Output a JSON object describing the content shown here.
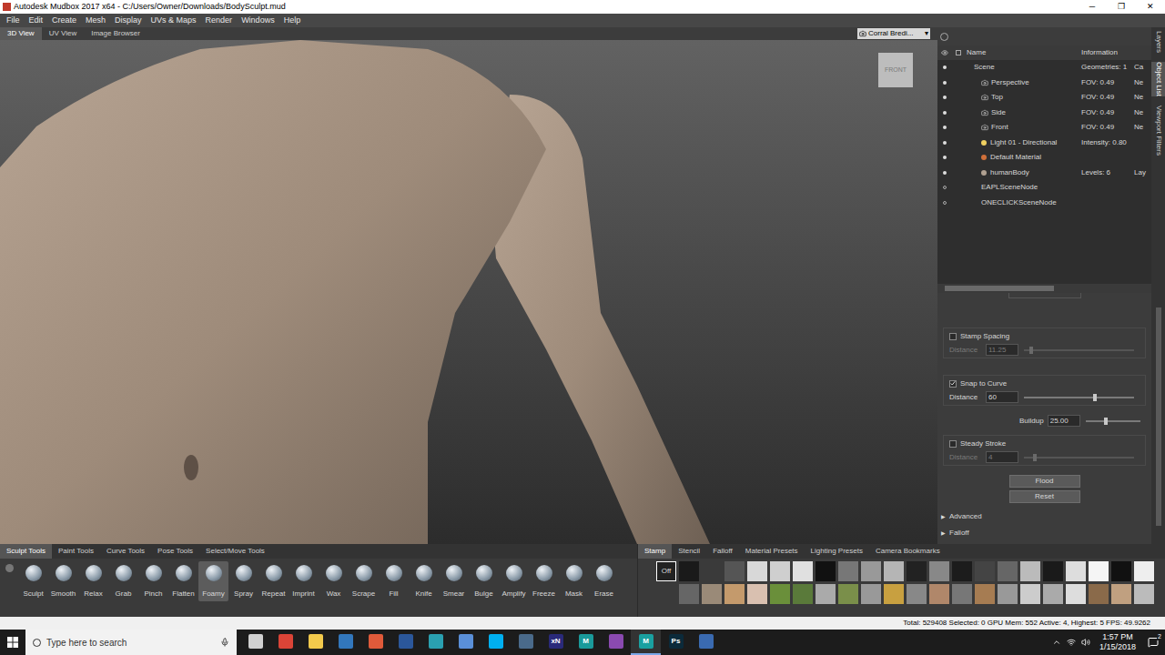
{
  "window": {
    "title": "Autodesk Mudbox 2017 x64 - C:/Users/Owner/Downloads/BodySculpt.mud",
    "controls": [
      "─",
      "❐",
      "✕"
    ]
  },
  "menu": [
    "File",
    "Edit",
    "Create",
    "Mesh",
    "Display",
    "UVs & Maps",
    "Render",
    "Windows",
    "Help"
  ],
  "view_tabs": [
    {
      "label": "3D View",
      "selected": true
    },
    {
      "label": "UV View",
      "selected": false
    },
    {
      "label": "Image Browser",
      "selected": false
    }
  ],
  "camera_menu": {
    "value": "Corral Bredi...",
    "arrow": "▾"
  },
  "viewcube": {
    "label": "FRONT"
  },
  "object_list": {
    "columns": [
      "Name",
      "Information"
    ],
    "rows": [
      {
        "name": "Scene",
        "info": "Geometries: 1",
        "extra": "Ca",
        "depth": 0,
        "kind": "scene",
        "visible": true
      },
      {
        "name": "Perspective",
        "info": "FOV: 0.49",
        "extra": "Ne",
        "depth": 1,
        "kind": "camera",
        "visible": true
      },
      {
        "name": "Top",
        "info": "FOV: 0.49",
        "extra": "Ne",
        "depth": 1,
        "kind": "camera",
        "visible": true
      },
      {
        "name": "Side",
        "info": "FOV: 0.49",
        "extra": "Ne",
        "depth": 1,
        "kind": "camera",
        "visible": true
      },
      {
        "name": "Front",
        "info": "FOV: 0.49",
        "extra": "Ne",
        "depth": 1,
        "kind": "camera",
        "visible": true
      },
      {
        "name": "Light 01 - Directional",
        "info": "Intensity: 0.80",
        "depth": 1,
        "kind": "light",
        "visible": true
      },
      {
        "name": "Default Material",
        "depth": 1,
        "kind": "material",
        "visible": true
      },
      {
        "name": "humanBody",
        "info": "Levels: 6",
        "extra": "Lay",
        "depth": 1,
        "kind": "mesh",
        "visible": true
      },
      {
        "name": "EAPLSceneNode",
        "depth": 1,
        "kind": "node",
        "visible": false
      },
      {
        "name": "ONECLICKSceneNode",
        "depth": 1,
        "kind": "node",
        "visible": false
      }
    ]
  },
  "properties": {
    "stamp_spacing": {
      "label": "Stamp Spacing",
      "checked": false,
      "field_label": "Distance",
      "value": "11.25",
      "level": 0.05,
      "disabled": true
    },
    "snap_to_curve": {
      "label": "Snap to Curve",
      "checked": true,
      "field_label": "Distance",
      "value": "60",
      "level": 0.63,
      "disabled": false
    },
    "buildup": {
      "label": "Buildup",
      "value": "25.00",
      "level": 0.34
    },
    "steady_stroke": {
      "label": "Steady Stroke",
      "checked": false,
      "field_label": "Distance",
      "value": "4",
      "level": 0.08,
      "disabled": true
    },
    "buttons": [
      "Flood",
      "Reset"
    ],
    "sections": [
      {
        "label": "Advanced",
        "expanded": false,
        "arrow": "▶"
      },
      {
        "label": "Falloff",
        "expanded": false,
        "arrow": "▶"
      }
    ]
  },
  "side_tabs": [
    {
      "label": "Layers",
      "selected": false
    },
    {
      "label": "Object List",
      "selected": true
    },
    {
      "label": "Viewport Filters",
      "selected": false
    }
  ],
  "tool_tabs": [
    {
      "label": "Sculpt Tools",
      "selected": true
    },
    {
      "label": "Paint Tools",
      "selected": false
    },
    {
      "label": "Curve Tools",
      "selected": false
    },
    {
      "label": "Pose Tools",
      "selected": false
    },
    {
      "label": "Select/Move Tools",
      "selected": false
    }
  ],
  "tools": [
    {
      "label": "Sculpt",
      "selected": false
    },
    {
      "label": "Smooth",
      "selected": false
    },
    {
      "label": "Relax",
      "selected": false
    },
    {
      "label": "Grab",
      "selected": false
    },
    {
      "label": "Pinch",
      "selected": false
    },
    {
      "label": "Flatten",
      "selected": false
    },
    {
      "label": "Foamy",
      "selected": true
    },
    {
      "label": "Spray",
      "selected": false
    },
    {
      "label": "Repeat",
      "selected": false
    },
    {
      "label": "Imprint",
      "selected": false
    },
    {
      "label": "Wax",
      "selected": false
    },
    {
      "label": "Scrape",
      "selected": false
    },
    {
      "label": "Fill",
      "selected": false
    },
    {
      "label": "Knife",
      "selected": false
    },
    {
      "label": "Smear",
      "selected": false
    },
    {
      "label": "Bulge",
      "selected": false
    },
    {
      "label": "Amplify",
      "selected": false
    },
    {
      "label": "Freeze",
      "selected": false
    },
    {
      "label": "Mask",
      "selected": false
    },
    {
      "label": "Erase",
      "selected": false
    }
  ],
  "stamp_tabs": [
    {
      "label": "Stamp",
      "selected": true
    },
    {
      "label": "Stencil",
      "selected": false
    },
    {
      "label": "Falloff",
      "selected": false
    },
    {
      "label": "Material Presets",
      "selected": false
    },
    {
      "label": "Lighting Presets",
      "selected": false
    },
    {
      "label": "Camera Bookmarks",
      "selected": false
    }
  ],
  "stamps": {
    "off": {
      "label": "Off",
      "selected": true
    },
    "rows": [
      [
        "#1a1a1a",
        "#3a3a3a",
        "#555555",
        "#d8d8d8",
        "#cfcfcf",
        "#e0e0e0",
        "#111111",
        "#777777",
        "#999999",
        "#b5b5b5",
        "#222222",
        "#888888",
        "#1c1c1c",
        "#444444",
        "#666666",
        "#bbbbbb",
        "#1a1a1a",
        "#dddddd",
        "#f5f5f5",
        "#111111",
        "#eeeeee"
      ],
      [
        "#3a3a3a",
        "#666666",
        "#9a8a78",
        "#c49a6c",
        "#d9c0b0",
        "#6a8f3a",
        "#5a7a3a",
        "#aaaaaa",
        "#7a8f4a",
        "#999999",
        "#c8a040",
        "#888888",
        "#b0876a",
        "#777777",
        "#a67c52",
        "#999999",
        "#cccccc",
        "#aaaaaa",
        "#dddddd",
        "#8a6a4a",
        "#c0a080",
        "#bbbbbb"
      ]
    ]
  },
  "status_bar": "Total: 529408 Selected: 0 GPU Mem: 552 Active: 4, Highest: 5 FPS: 49.9262",
  "taskbar": {
    "search_placeholder": "Type here to search",
    "apps": [
      {
        "color": "#d0d0d0",
        "active": false
      },
      {
        "color": "#db4437",
        "active": false
      },
      {
        "color": "#f2c94c",
        "active": false
      },
      {
        "color": "#3277bc",
        "active": false
      },
      {
        "color": "#e05a3a",
        "active": false
      },
      {
        "color": "#2b579a",
        "active": false
      },
      {
        "color": "#2aa0b0",
        "active": false
      },
      {
        "color": "#5a8fd8",
        "active": false
      },
      {
        "color": "#00aff0",
        "active": false
      },
      {
        "color": "#4a6a8a",
        "active": false
      },
      {
        "color": "#2a2a7a",
        "glyph": "xN",
        "active": false
      },
      {
        "color": "#1a9a9a",
        "glyph": "M",
        "active": false
      },
      {
        "color": "#8a4ab0",
        "active": false
      },
      {
        "color": "#1aa0a0",
        "glyph": "M",
        "active": true
      },
      {
        "color": "#0b2a3a",
        "glyph": "Ps",
        "active": false
      },
      {
        "color": "#3a6ab0",
        "active": false
      }
    ],
    "time": "1:57 PM",
    "date": "1/15/2018",
    "notifications": "2"
  }
}
